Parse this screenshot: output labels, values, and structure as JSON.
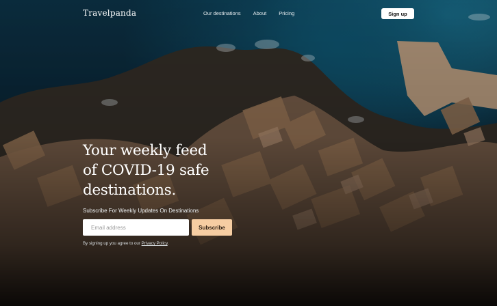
{
  "nav": {
    "logo": "Travelpanda",
    "links": [
      "Our destinations",
      "About",
      "Pricing"
    ],
    "signup_label": "Sign up"
  },
  "hero": {
    "headline_lines": [
      "Your weekly feed",
      "of COVID-19 safe",
      "destinations."
    ],
    "subtitle": "Subscribe For Weekly Updates On Destinations",
    "email_placeholder": "Email address",
    "subscribe_label": "Subscribe",
    "disclaimer_prefix": "By signing up you agree to our ",
    "privacy_link": "Privacy Policy",
    "disclaimer_suffix": "."
  },
  "colors": {
    "accent": "#f6cda2",
    "sea": "#0e4d66",
    "roof": "#8a6a4e"
  },
  "background_image": "aerial coastal town photo"
}
